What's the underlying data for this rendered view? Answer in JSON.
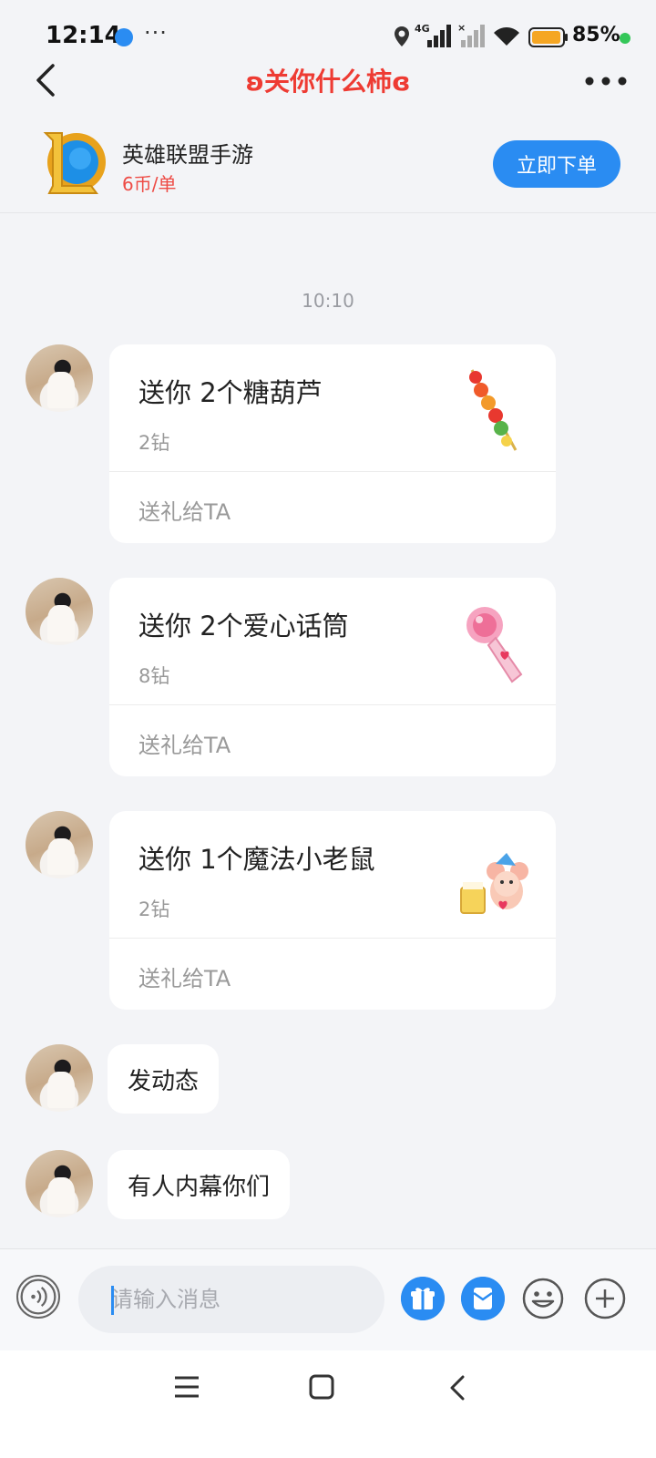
{
  "status_bar": {
    "time": "12:14",
    "more": "···",
    "network": "4G",
    "battery_percent": "85%",
    "battery_level": 0.85
  },
  "nav": {
    "title": "ʚ关你什么柿ɞ"
  },
  "banner": {
    "game_name": "英雄联盟手游",
    "price": "6币/单",
    "order_button": "立即下单"
  },
  "chat": {
    "timestamp": "10:10",
    "messages": [
      {
        "type": "gift",
        "title": "送你 2个糖葫芦",
        "cost": "2钻",
        "action": "送礼给TA",
        "icon": "candied-haws-icon"
      },
      {
        "type": "gift",
        "title": "送你 2个爱心话筒",
        "cost": "8钻",
        "action": "送礼给TA",
        "icon": "heart-microphone-icon"
      },
      {
        "type": "gift",
        "title": "送你 1个魔法小老鼠",
        "cost": "2钻",
        "action": "送礼给TA",
        "icon": "magic-mouse-icon"
      },
      {
        "type": "text",
        "text": "发动态"
      },
      {
        "type": "text",
        "text": "有人内幕你们"
      }
    ]
  },
  "input_bar": {
    "placeholder": "请输入消息"
  },
  "colors": {
    "accent": "#2a8cf2",
    "title_red": "#ee3b33",
    "price_red": "#ee4b45"
  }
}
